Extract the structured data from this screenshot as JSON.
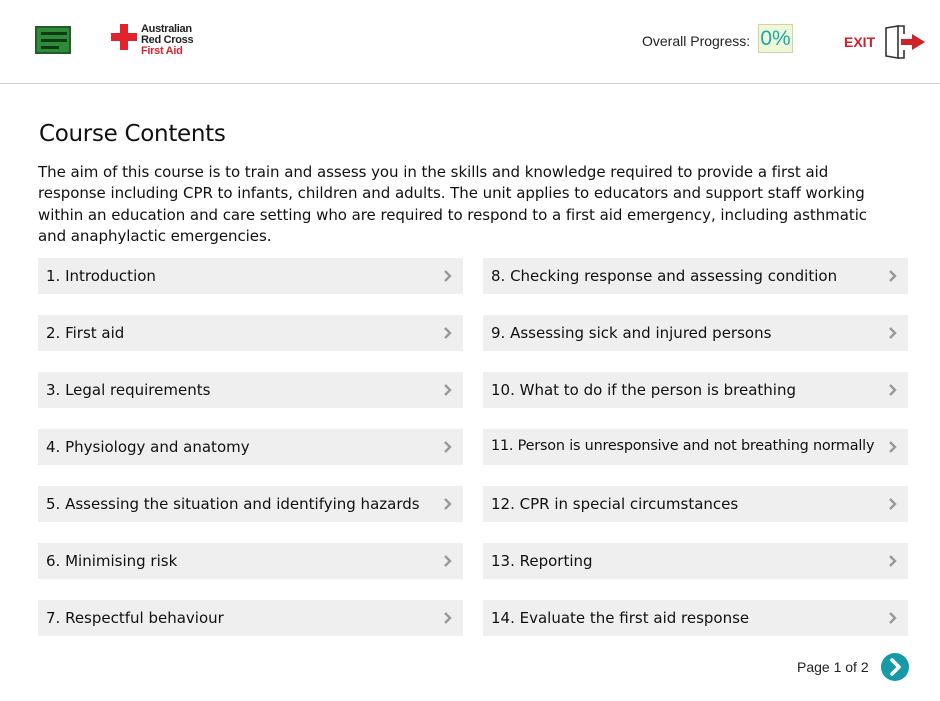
{
  "header": {
    "menu_icon": "hamburger-menu-icon",
    "logo": {
      "line1": "Australian",
      "line2": "Red Cross",
      "line3": "First Aid"
    },
    "progress_label": "Overall Progress:",
    "progress_value": "0%",
    "exit_label": "EXIT",
    "exit_icon": "exit-door-arrow-icon"
  },
  "main": {
    "title": "Course Contents",
    "intro": "The aim of this course is to train and assess you in the skills and knowledge required to provide a first aid response including CPR to infants, children and adults. The unit applies to educators and support staff working within an education and care setting who are required to respond to a first aid emergency, including asthmatic and anaphylactic emergencies.",
    "items": [
      "1. Introduction",
      "2. First aid",
      "3. Legal requirements",
      "4. Physiology and anatomy",
      "5. Assessing the situation and identifying hazards",
      "6. Minimising risk",
      "7. Respectful behaviour",
      "8. Checking response and assessing condition",
      "9. Assessing sick and injured persons",
      "10. What to do if the person is breathing",
      "11. Person is unresponsive and not breathing normally",
      "12. CPR in special circumstances",
      "13. Reporting",
      "14. Evaluate the first aid response"
    ]
  },
  "footer": {
    "page_label": "Page 1 of 2",
    "next_icon": "chevron-right-circle-icon"
  },
  "colors": {
    "brand_red": "#e0232f",
    "menu_green": "#2e8b3a",
    "accent_teal": "#159aa6",
    "item_bg": "#efefef"
  }
}
